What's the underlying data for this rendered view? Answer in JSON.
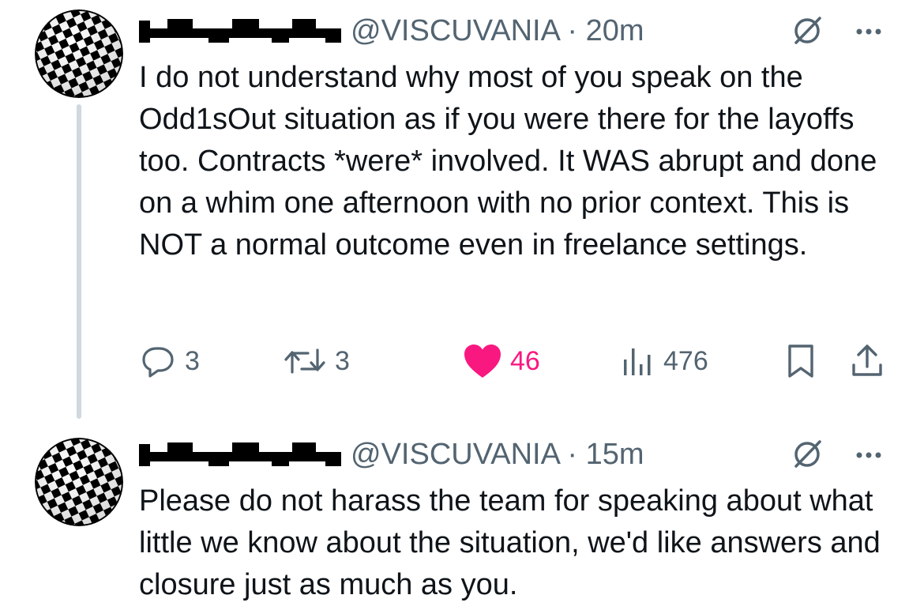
{
  "tweets": [
    {
      "handle": "@VISCUVANIA",
      "separator": "·",
      "time": "20m",
      "text": "I do not understand why most of you speak on the Odd1sOut situation as if you were there for the layoffs too. Contracts *were* involved. It WAS abrupt and done on a whim one afternoon with no prior context. This is NOT a normal outcome even in freelance settings.",
      "actions": {
        "replies": "3",
        "reposts": "3",
        "likes": "46",
        "views": "476"
      },
      "liked": true
    },
    {
      "handle": "@VISCUVANIA",
      "separator": "·",
      "time": "15m",
      "text": "Please do not harass the team for speaking about what little we know about the situation, we'd like answers and closure just as much as you."
    }
  ],
  "icons": {
    "avatar": "checkered-ball-avatar",
    "display_name": "checkered-bar-name-graphic",
    "grok": "grok-slash-circle-icon",
    "more": "more-dots-icon",
    "reply": "reply-bubble-icon",
    "repost": "repost-arrows-icon",
    "like": "heart-icon",
    "views": "views-bars-icon",
    "bookmark": "bookmark-icon",
    "share": "share-upload-icon"
  },
  "colors": {
    "text": "#0f1419",
    "secondary": "#536471",
    "like_active": "#f91880",
    "thread_line": "#cfd9de",
    "background": "#ffffff"
  }
}
